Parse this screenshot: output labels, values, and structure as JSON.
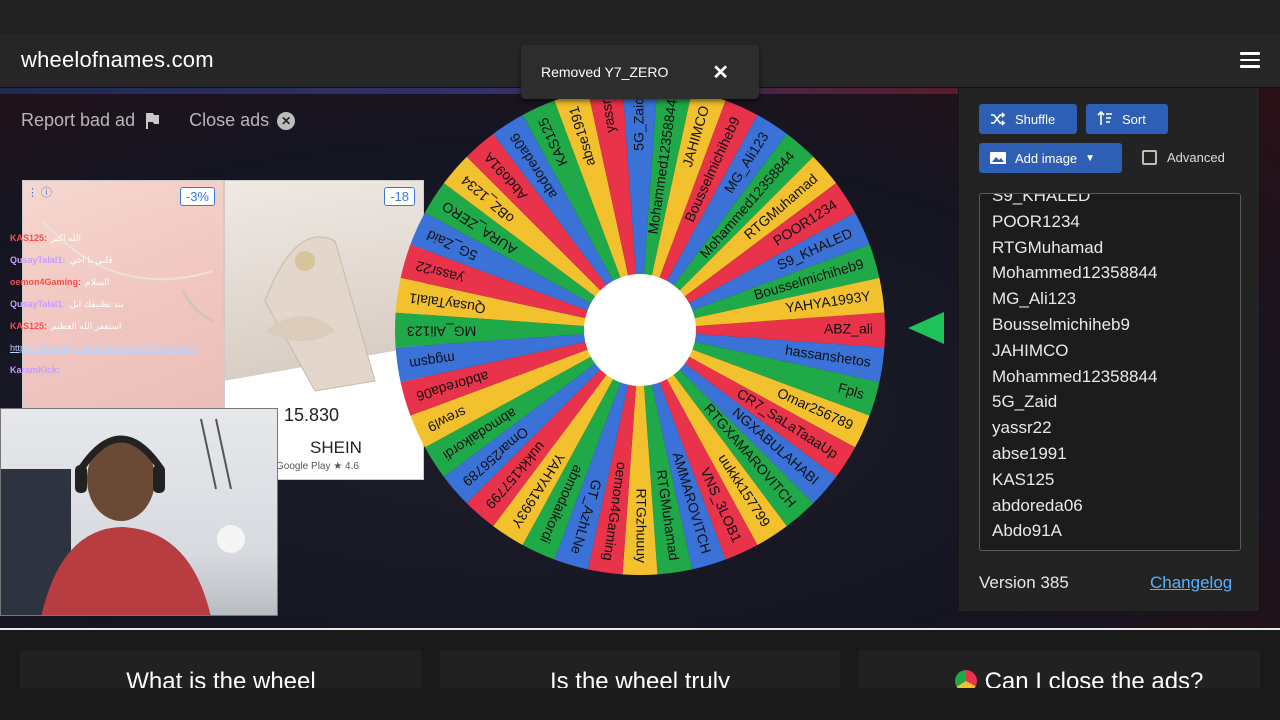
{
  "app": {
    "title": "wheelofnames.com",
    "accent": "#2f5fb5"
  },
  "ads": {
    "report_label": "Report bad ad",
    "close_label": "Close ads",
    "discount_left": "-3%",
    "discount_right": "-18",
    "price": "15.830",
    "brand": "SHEIN",
    "store": "Google Play",
    "rating": "★ 4.6"
  },
  "stream_chat": {
    "messages": [
      {
        "user": "KAS125:",
        "text": "الله اكبر"
      },
      {
        "user": "QusayTalal1:",
        "text": "قلبي يا اخي"
      },
      {
        "user": "oemon4Gaming:",
        "text": "السلام"
      },
      {
        "user": "QusayTalal1:",
        "text": "بند تطبيقك ابل"
      },
      {
        "user": "KAS125:",
        "text": "استغفر الله العظيم"
      },
      {
        "user": "KaramKick:",
        "text": ""
      }
    ],
    "link": "https://whatsapp.com/channel/0029Vb5aBa1A"
  },
  "toast": {
    "message": "Removed Y7_ZERO",
    "close_icon": "close-icon"
  },
  "wheel": {
    "colors": [
      "#e8334a",
      "#3a72d8",
      "#1fa948",
      "#f3c12d"
    ],
    "segments": [
      "ABZ_ali",
      "hassanshetos",
      "Fpls",
      "Omar256789",
      "CR7_SaLaTaaaUp",
      "NGXABULAHABI",
      "RTGXAMAROVITCH",
      "uukkk157799",
      "VNS_3LOB1",
      "AMMAROVITCH",
      "RTGMuhamad",
      "RTGzhuuuy",
      "oemon4Gaming",
      "GT_AzhLNe",
      "abmodaikordi",
      "YAHYA1993Y",
      "uukkk157799",
      "Omar256789",
      "abmodaikordi",
      "srewl9",
      "abdoreda06",
      "mgqsm",
      "MG_Ali123",
      "QusayTalal1",
      "yassr22",
      "5G_Zaid",
      "AURA_ZERO",
      "oBZ_1234",
      "Abdo91A",
      "abdoreda06",
      "KAS125",
      "abse1991",
      "yassr",
      "5G_Zaid",
      "Mohammed12358844",
      "JAHIMCO",
      "Bousselmichiheb9",
      "MG_Ali123",
      "Mohammed12358844",
      "RTGMuhamad",
      "POOR1234",
      "S9_KHALED",
      "Bousselmichiheb9",
      "YAHYA1993Y"
    ]
  },
  "panel": {
    "shuffle_label": "Shuffle",
    "sort_label": "Sort",
    "add_image_label": "Add image",
    "advanced_label": "Advanced",
    "entries": [
      "S9_KHALED",
      "POOR1234",
      "RTGMuhamad",
      "Mohammed12358844",
      "MG_Ali123",
      "Bousselmichiheb9",
      "JAHIMCO",
      "Mohammed12358844",
      "5G_Zaid",
      "yassr22",
      "abse1991",
      "KAS125",
      "abdoreda06",
      "Abdo91A"
    ],
    "version": "Version 385",
    "changelog_label": "Changelog"
  },
  "faq": {
    "q1": "What is the wheel",
    "q2": "Is the wheel truly",
    "q3": "Can I close the ads?"
  }
}
